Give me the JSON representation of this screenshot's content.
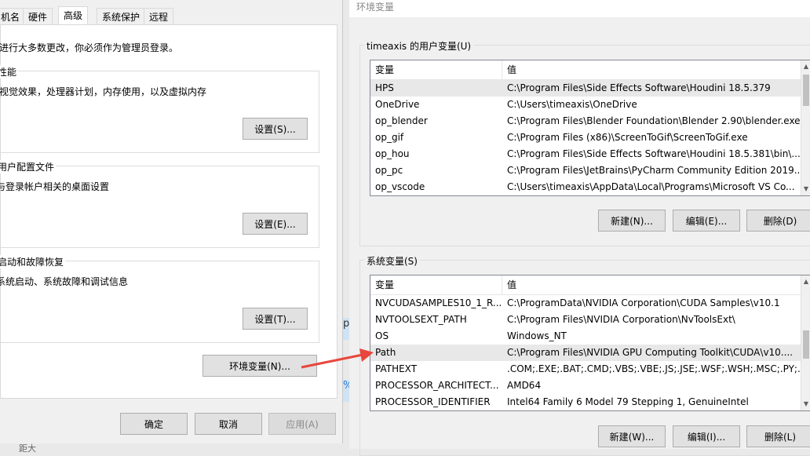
{
  "left": {
    "tabs": [
      "机名",
      "硬件",
      "高级",
      "系统保护",
      "远程"
    ],
    "admin_note": "进行大多数更改，你必须作为管理员登录。",
    "performance": {
      "title": "性能",
      "desc": "视觉效果，处理器计划，内存使用，以及虚拟内存",
      "button": "设置(S)..."
    },
    "profiles": {
      "title": "用户配置文件",
      "desc": "与登录帐户相关的桌面设置",
      "button": "设置(E)..."
    },
    "startup": {
      "title": "启动和故障恢复",
      "desc": "系统启动、系统故障和调试信息",
      "button": "设置(T)..."
    },
    "env_button": "环境变量(N)...",
    "ok": "确定",
    "cancel": "取消",
    "apply": "应用(A)",
    "bg_fragment_1": "p",
    "bg_fragment_2": "%",
    "bg_fragment_3": "距大"
  },
  "right": {
    "title": "环境变量",
    "user_section_title": "timeaxis 的用户变量(U)",
    "system_section_title": "系统变量(S)",
    "col_var": "变量",
    "col_val": "值",
    "user_vars": [
      {
        "name": "HPS",
        "value": "C:\\Program Files\\Side Effects Software\\Houdini 18.5.379"
      },
      {
        "name": "OneDrive",
        "value": "C:\\Users\\timeaxis\\OneDrive"
      },
      {
        "name": "op_blender",
        "value": "C:\\Program Files\\Blender Foundation\\Blender 2.90\\blender.exe"
      },
      {
        "name": "op_gif",
        "value": "C:\\Program Files (x86)\\ScreenToGif\\ScreenToGif.exe"
      },
      {
        "name": "op_hou",
        "value": "C:\\Program Files\\Side Effects Software\\Houdini 18.5.381\\bin\\..."
      },
      {
        "name": "op_pc",
        "value": "C:\\Program Files\\JetBrains\\PyCharm Community Edition 2019...."
      },
      {
        "name": "op_vscode",
        "value": "C:\\Users\\timeaxis\\AppData\\Local\\Programs\\Microsoft VS Co..."
      }
    ],
    "system_vars": [
      {
        "name": "NVCUDASAMPLES10_1_R...",
        "value": "C:\\ProgramData\\NVIDIA Corporation\\CUDA Samples\\v10.1"
      },
      {
        "name": "NVTOOLSEXT_PATH",
        "value": "C:\\Program Files\\NVIDIA Corporation\\NvToolsExt\\"
      },
      {
        "name": "OS",
        "value": "Windows_NT"
      },
      {
        "name": "Path",
        "value": "C:\\Program Files\\NVIDIA GPU Computing Toolkit\\CUDA\\v10...."
      },
      {
        "name": "PATHEXT",
        "value": ".COM;.EXE;.BAT;.CMD;.VBS;.VBE;.JS;.JSE;.WSF;.WSH;.MSC;.PY;.P..."
      },
      {
        "name": "PROCESSOR_ARCHITECT...",
        "value": "AMD64"
      },
      {
        "name": "PROCESSOR_IDENTIFIER",
        "value": "Intel64 Family 6 Model 79 Stepping 1, GenuineIntel"
      }
    ],
    "user_buttons": {
      "new": "新建(N)...",
      "edit": "编辑(E)...",
      "delete": "删除(D)"
    },
    "system_buttons": {
      "new": "新建(W)...",
      "edit": "编辑(I)...",
      "delete": "删除(L)"
    }
  },
  "colors": {
    "arrow": "#e8473c",
    "selection": "#e8e8e8"
  }
}
